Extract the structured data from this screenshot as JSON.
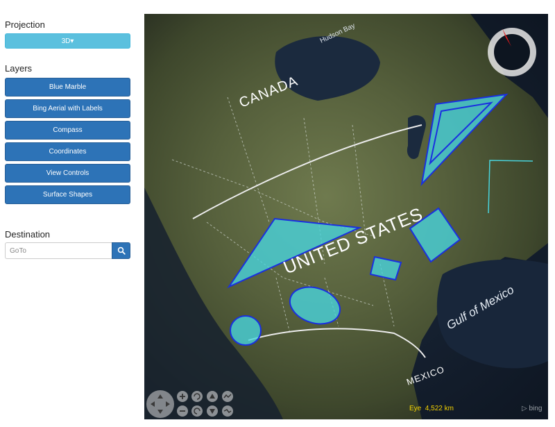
{
  "projection": {
    "title": "Projection",
    "selected": "3D▾"
  },
  "layers": {
    "title": "Layers",
    "items": [
      {
        "label": "Blue Marble"
      },
      {
        "label": "Bing Aerial with Labels"
      },
      {
        "label": "Compass"
      },
      {
        "label": "Coordinates"
      },
      {
        "label": "View Controls"
      },
      {
        "label": "Surface Shapes"
      }
    ]
  },
  "destination": {
    "title": "Destination",
    "placeholder": "GoTo",
    "search_icon": "search-icon"
  },
  "map": {
    "labels": {
      "hudson_bay": "Hudson Bay",
      "canada": "CANADA",
      "united_states": "UNITED STATES",
      "gulf_of_mexico": "Gulf of Mexico",
      "mexico": "MEXICO"
    },
    "eye_label": "Eye",
    "eye_value": "4,522 km",
    "attribution": "bing",
    "shape_fill": "#49d3dc",
    "shape_outline": "#1a2fe0",
    "compass_needle": "#e21b1b"
  }
}
